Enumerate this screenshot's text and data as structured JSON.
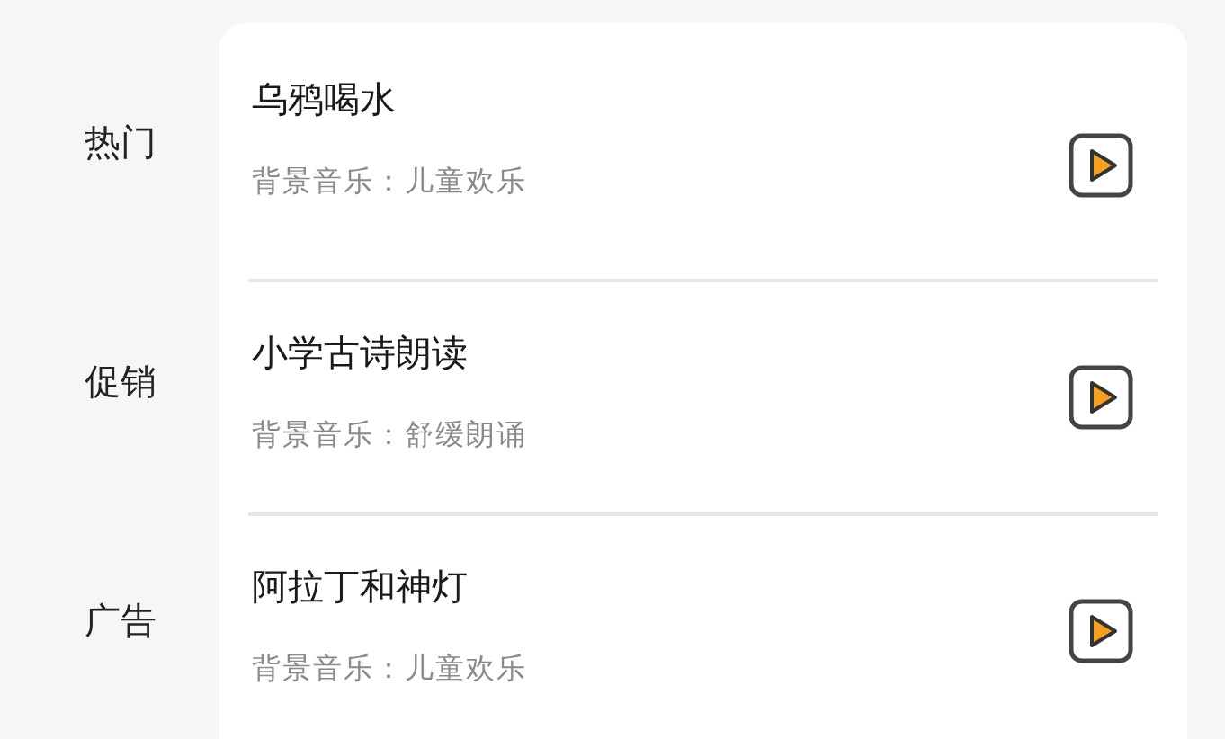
{
  "sidebar": {
    "items": [
      {
        "label": "热门"
      },
      {
        "label": "促销"
      },
      {
        "label": "广告"
      }
    ]
  },
  "list": {
    "items": [
      {
        "title": "乌鸦喝水",
        "subtitle": "背景音乐：儿童欢乐"
      },
      {
        "title": "小学古诗朗读",
        "subtitle": "背景音乐：舒缓朗诵"
      },
      {
        "title": "阿拉丁和神灯",
        "subtitle": "背景音乐：儿童欢乐"
      }
    ]
  }
}
